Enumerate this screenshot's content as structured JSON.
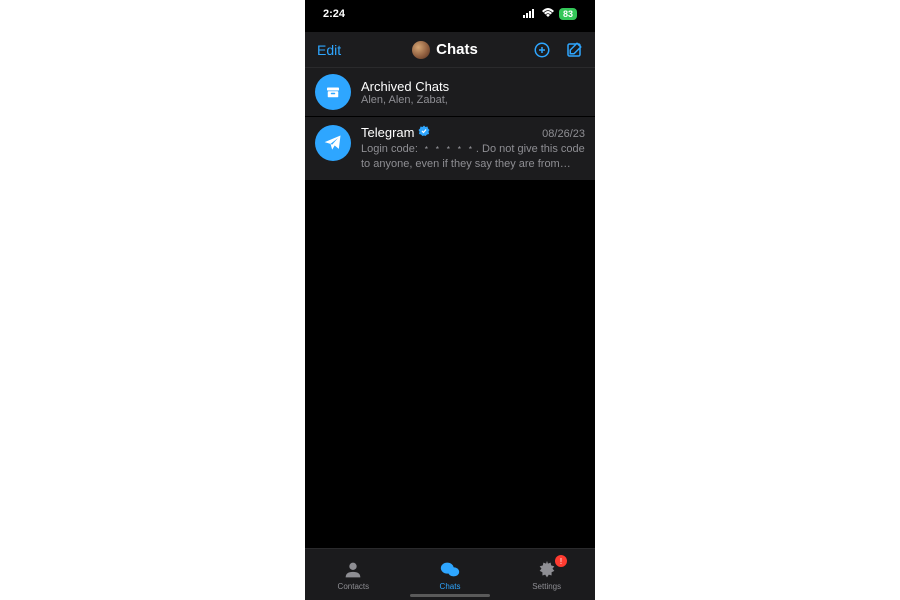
{
  "status": {
    "time": "2:24",
    "signal": "ııl",
    "battery": "83"
  },
  "nav": {
    "edit": "Edit",
    "title": "Chats"
  },
  "archived": {
    "title": "Archived Chats",
    "subtitle": "Alen, Alen, Zabat,"
  },
  "chats": [
    {
      "name": "Telegram",
      "date": "08/26/23",
      "preview": "Login code: ﹡﹡﹡﹡﹡. Do not give this code to anyone, even if they say they are from Telegra…"
    }
  ],
  "tabs": {
    "contacts": "Contacts",
    "chats": "Chats",
    "settings": "Settings",
    "badge": "!"
  }
}
